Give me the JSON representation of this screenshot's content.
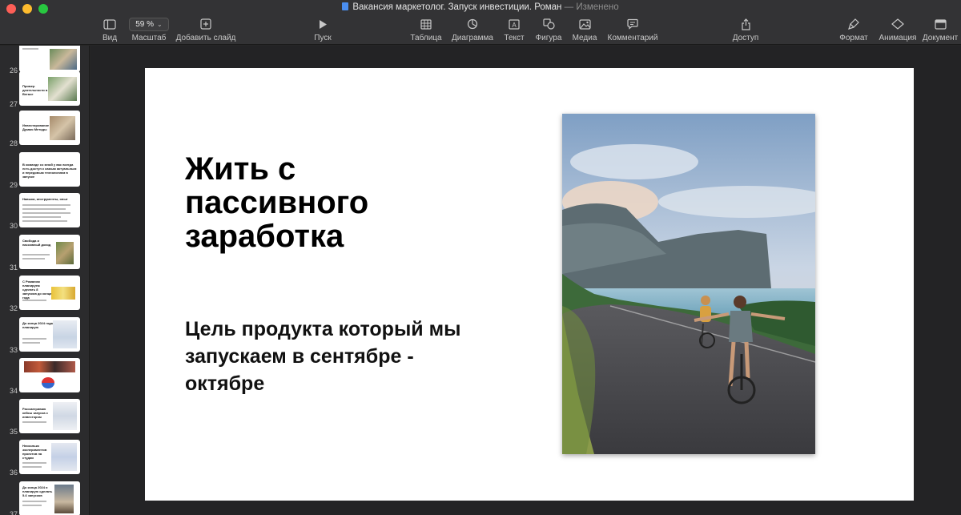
{
  "window": {
    "title": "Вакансия маркетолог. Запуск инвестиции. Роман",
    "separator": "—",
    "status": "Изменено"
  },
  "toolbar": {
    "view": "Вид",
    "zoom_value": "59 %",
    "zoom_label": "Масштаб",
    "add_slide": "Добавить слайд",
    "play": "Пуск",
    "table": "Таблица",
    "chart": "Диаграмма",
    "text": "Текст",
    "shape": "Фигура",
    "media": "Медиа",
    "comment": "Комментарий",
    "share": "Доступ",
    "format": "Формат",
    "animate": "Анимация",
    "document": "Документ"
  },
  "sidebar": {
    "slides": [
      {
        "number": "26",
        "title": "",
        "kind": "image"
      },
      {
        "number": "27",
        "title": "Пример деятельности в Вегасе",
        "kind": "image"
      },
      {
        "number": "28",
        "title": "Инвестирование в Думаю Методы",
        "kind": "image"
      },
      {
        "number": "29",
        "title": "В команде со мной у вас всегда есть доступ к самым актуальным и передовым технологиям в запуске",
        "kind": "text"
      },
      {
        "number": "30",
        "title": "Навыки, инструменты, опыт",
        "kind": "list"
      },
      {
        "number": "31",
        "title": "Свобода и пассивный доход",
        "kind": "image"
      },
      {
        "number": "32",
        "title": "С Романом планируем сделать 8 запусков до конца года",
        "kind": "image"
      },
      {
        "number": "33",
        "title": "До конца 2024 года планирую",
        "kind": "image"
      },
      {
        "number": "34",
        "title": "",
        "kind": "image"
      },
      {
        "number": "35",
        "title": "Рассматриваю кейсы запуска с инвестором",
        "kind": "image"
      },
      {
        "number": "36",
        "title": "Несколько экспериментов проектов на студии",
        "kind": "image"
      },
      {
        "number": "37",
        "title": "До конца 2024 я планирую сделать 5-6 запусков",
        "kind": "image"
      }
    ]
  },
  "slide": {
    "headline": "Жить с пассивного заработка",
    "subline": "Цель продукта который мы запускаем в сентябре - октябре",
    "photo": "children-riding-bicycles-on-coastal-road"
  },
  "colors": {
    "toolbar_bg": "#333335",
    "sidebar_bg": "#2b2b2d",
    "canvas_bg": "#232325",
    "slide_bg": "#ffffff"
  }
}
